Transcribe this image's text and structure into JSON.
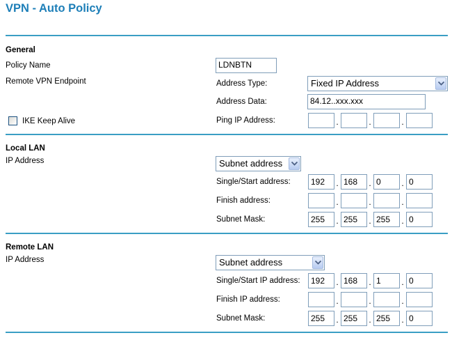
{
  "page": {
    "title": "VPN - Auto Policy"
  },
  "general": {
    "header": "General",
    "policy_name_label": "Policy Name",
    "policy_name_value": "LDNBTN",
    "remote_endpoint_label": "Remote VPN Endpoint",
    "address_type_label": "Address Type:",
    "address_type_value": "Fixed IP Address",
    "address_data_label": "Address Data:",
    "address_data_value": "84.12..xxx.xxx",
    "ike_keep_alive_label": "IKE Keep Alive",
    "ike_keep_alive_checked": false,
    "ping_ip_label": "Ping IP Address:",
    "ping_ip": [
      "",
      "",
      "",
      ""
    ]
  },
  "local_lan": {
    "header": "Local LAN",
    "ip_address_label": "IP Address",
    "type_value": "Subnet address",
    "start_label": "Single/Start address:",
    "start": [
      "192",
      "168",
      "0",
      "0"
    ],
    "finish_label": "Finish address:",
    "finish": [
      "",
      "",
      "",
      ""
    ],
    "mask_label": "Subnet Mask:",
    "mask": [
      "255",
      "255",
      "255",
      "0"
    ]
  },
  "remote_lan": {
    "header": "Remote LAN",
    "ip_address_label": "IP Address",
    "type_value": "Subnet address",
    "start_label": "Single/Start IP address:",
    "start": [
      "192",
      "168",
      "1",
      "0"
    ],
    "finish_label": "Finish IP address:",
    "finish": [
      "",
      "",
      "",
      ""
    ],
    "mask_label": "Subnet Mask:",
    "mask": [
      "255",
      "255",
      "255",
      "0"
    ]
  },
  "colors": {
    "title": "#1e7fb8",
    "rule": "#3a9ec4",
    "input_border": "#7f9db9"
  },
  "icons": {
    "dropdown": "chevron-down-icon"
  }
}
